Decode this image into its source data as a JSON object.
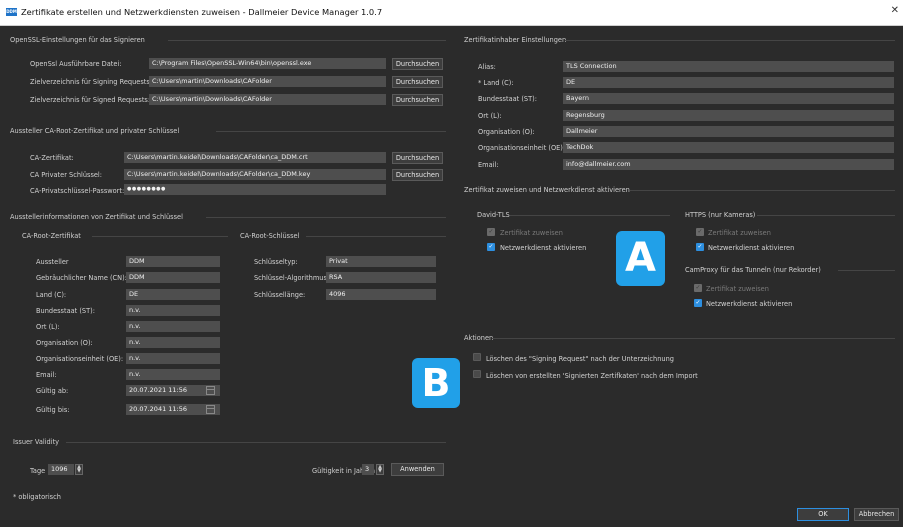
{
  "window": {
    "title": "Zertifikate erstellen und Netzwerkdiensten zuweisen - Dallmeier Device Manager 1.0.7",
    "icon_text": "DDM"
  },
  "openssl": {
    "header": "OpenSSL-Einstellungen für das Signieren",
    "rows": [
      {
        "label": "OpenSsl Ausführbare Datei:",
        "value": "C:\\Program Files\\OpenSSL-Win64\\bin\\openssl.exe",
        "button": "Durchsuchen"
      },
      {
        "label": "Zielverzeichnis für  Signing Requests:",
        "value": "C:\\Users\\martin\\Downloads\\CAFolder",
        "button": "Durchsuchen"
      },
      {
        "label": "Zielverzeichnis für Signed Requests:",
        "value": "C:\\Users\\martin\\Downloads\\CAFolder",
        "button": "Durchsuchen"
      }
    ]
  },
  "issuer_ca": {
    "header": "Aussteller CA-Root-Zertifikat und privater Schlüssel",
    "rows": [
      {
        "label": "CA-Zertifikat:",
        "value": "C:\\Users\\martin.keidel\\Downloads\\CAFolder\\ca_DDM.crt",
        "button": "Durchsuchen"
      },
      {
        "label": "CA Privater Schlüssel:",
        "value": "C:\\Users\\martin.keidel\\Downloads\\CAFolder\\ca_DDM.key",
        "button": "Durchsuchen"
      },
      {
        "label": "CA-Privatschlüssel-Passwort:",
        "value": "●●●●●●●●",
        "button": ""
      }
    ]
  },
  "issuer_info": {
    "header": "Ausstellerinformationen von Zertifikat und Schlüssel",
    "root_cert": {
      "header": "CA-Root-Zertifikat",
      "rows": [
        {
          "label": "Aussteller",
          "value": "DDM"
        },
        {
          "label": "Gebräuchlicher Name (CN):",
          "value": "DDM"
        },
        {
          "label": "Land (C):",
          "value": "DE"
        },
        {
          "label": "Bundesstaat (ST):",
          "value": "n.v."
        },
        {
          "label": "Ort (L):",
          "value": "n.v."
        },
        {
          "label": "Organisation (O):",
          "value": "n.v."
        },
        {
          "label": "Organisationseinheit (OE):",
          "value": "n.v."
        },
        {
          "label": "Email:",
          "value": "n.v."
        },
        {
          "label": "Gültig ab:",
          "value": "20.07.2021 11:56"
        },
        {
          "label": "Gültig bis:",
          "value": "20.07.2041 11:56"
        }
      ]
    },
    "root_key": {
      "header": "CA-Root-Schlüssel",
      "rows": [
        {
          "label": "Schlüsseltyp:",
          "value": "Privat"
        },
        {
          "label": "Schlüssel-Algorithmus:",
          "value": "RSA"
        },
        {
          "label": "Schlüssellänge:",
          "value": "4096"
        }
      ]
    }
  },
  "validity": {
    "header": "Issuer Validity",
    "days_label": "Tage",
    "days_value": "1096",
    "years_label": "Gültigkeit in Jahren",
    "years_value": "3",
    "apply_button": "Anwenden",
    "required_note": "* obligatorisch"
  },
  "holder": {
    "header": "Zertifikatinhaber Einstellungen",
    "rows": [
      {
        "label": "Alias:",
        "value": "TLS Connection"
      },
      {
        "label": "* Land (C):",
        "value": "DE"
      },
      {
        "label": "Bundesstaat (ST):",
        "value": "Bayern"
      },
      {
        "label": "Ort (L):",
        "value": "Regensburg"
      },
      {
        "label": "Organisation (O):",
        "value": "Dallmeier"
      },
      {
        "label": "Organisationseinheit (OE):",
        "value": "TechDok"
      },
      {
        "label": "Email:",
        "value": "info@dallmeier.com"
      }
    ]
  },
  "assign": {
    "header": "Zertifikat zuweisen und Netzwerkdienst aktivieren",
    "david_tls": {
      "title": "David-TLS",
      "assign_label": "Zertifikat zuweisen",
      "activate_label": "Netzwerkdienst aktivieren"
    },
    "https": {
      "title": "HTTPS (nur Kameras)",
      "assign_label": "Zertifikat zuweisen",
      "activate_label": "Netzwerkdienst aktivieren"
    },
    "camproxy": {
      "title": "CamProxy für das Tunneln (nur Rekorder)",
      "assign_label": "Zertifikat zuweisen",
      "activate_label": "Netzwerkdienst aktivieren"
    }
  },
  "actions": {
    "header": "Aktionen",
    "delete_request": "Löschen des \"Signing Request\" nach der Unterzeichnung",
    "delete_signed": "Löschen von erstellten 'Signierten Zertifkaten' nach dem Import"
  },
  "footer": {
    "ok": "OK",
    "cancel": "Abbrechen"
  },
  "badges": {
    "a": "A",
    "b": "B"
  },
  "colors": {
    "accent": "#2d8fe0",
    "badge": "#21a0e8",
    "background": "#2b2b2b",
    "field": "#4e4e4e"
  }
}
